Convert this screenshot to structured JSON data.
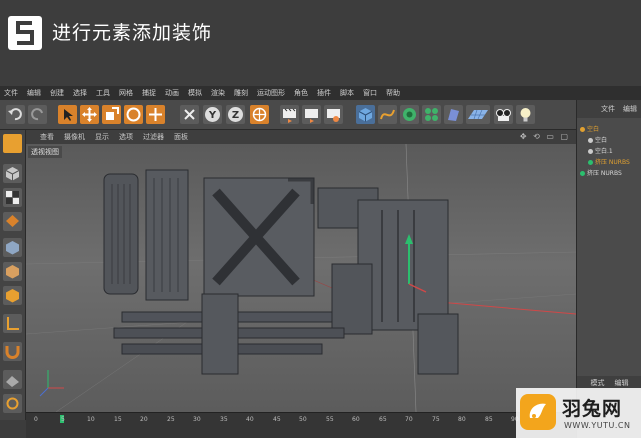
{
  "banner": {
    "title": "进行元素添加装饰",
    "logo_letter": "S"
  },
  "menu": [
    "文件",
    "编辑",
    "创建",
    "选择",
    "工具",
    "网格",
    "捕捉",
    "动画",
    "模拟",
    "渲染",
    "雕刻",
    "运动图形",
    "角色",
    "插件",
    "脚本",
    "窗口",
    "帮助"
  ],
  "toolbar": {
    "icons": [
      "undo-icon",
      "cursor-icon",
      "move-icon",
      "scale-icon",
      "rotate-icon",
      "plus-icon",
      "x-axis-icon",
      "y-axis-icon",
      "z-axis-icon",
      "world-icon",
      "render-region-icon",
      "render-view-icon",
      "render-settings-icon",
      "cube-icon",
      "pen-spline-icon",
      "subdivide-icon",
      "cloner-icon",
      "deformer-icon",
      "floor-icon",
      "camera-icon",
      "light-icon"
    ],
    "axis_labels": {
      "x": "X",
      "y": "Y",
      "z": "Z"
    }
  },
  "viewport": {
    "menu": [
      "查看",
      "摄像机",
      "显示",
      "选项",
      "过滤器",
      "面板"
    ],
    "label": "透视视图",
    "nav_icons": "✥ ⟲ ▭ ▢"
  },
  "object_panel": {
    "tabs": [
      "文件",
      "编辑"
    ],
    "items": [
      {
        "name": "空白",
        "level": 0,
        "selected": true,
        "color": "#e0a030"
      },
      {
        "name": "空白",
        "level": 1,
        "selected": false,
        "color": "#dddddd"
      },
      {
        "name": "空白.1",
        "level": 1,
        "selected": false,
        "color": "#dddddd"
      },
      {
        "name": "挤压 NURBS",
        "level": 1,
        "selected": true,
        "color": "#2bbf6e"
      },
      {
        "name": "挤压 NURBS",
        "level": 0,
        "selected": false,
        "color": "#2bbf6e"
      }
    ],
    "bottom_tabs": [
      "模式",
      "编辑"
    ]
  },
  "timeline": {
    "ticks": [
      "0",
      "5",
      "10",
      "15",
      "20",
      "25",
      "30",
      "35",
      "40",
      "45",
      "50",
      "55",
      "60",
      "65",
      "70",
      "75",
      "80",
      "85",
      "90"
    ]
  },
  "watermark": {
    "name": "羽兔网",
    "url": "WWW.YUTU.CN"
  },
  "colors": {
    "accent_green": "#2bbf6e",
    "selection_orange": "#e0a030",
    "brand_orange": "#f3a51c"
  }
}
